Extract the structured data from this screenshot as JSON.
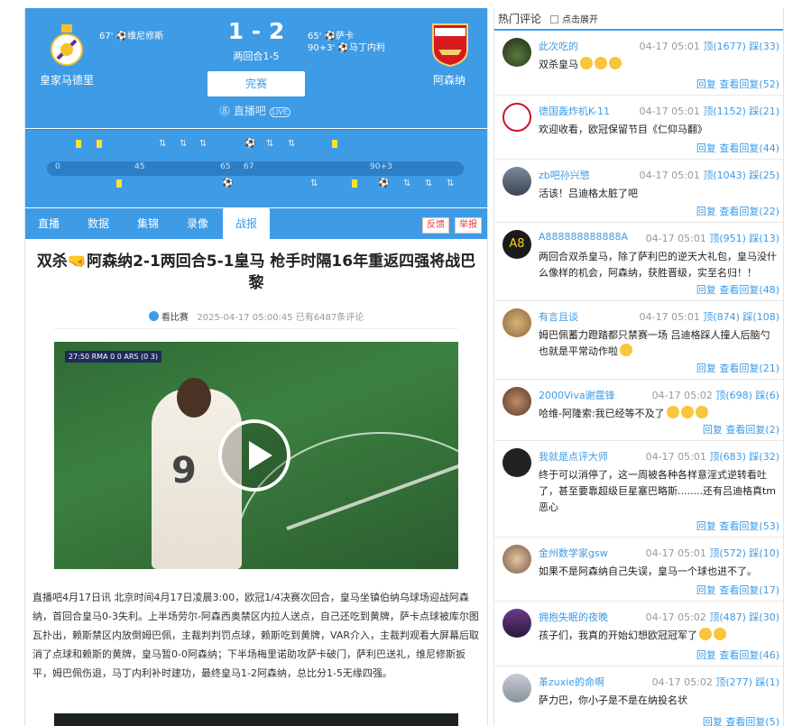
{
  "match": {
    "home_team": "皇家马德里",
    "away_team": "阿森纳",
    "home_scorers": [
      {
        "minute": "67'",
        "name": "维尼修斯"
      }
    ],
    "away_scorers": [
      {
        "minute": "65'",
        "name": "萨卡"
      },
      {
        "minute": "90+3'",
        "name": "马丁内利"
      }
    ],
    "score": "1 - 2",
    "aggregate": "两回合1-5",
    "status": "完赛",
    "brand": "直播吧",
    "brand_tag": "LIVE",
    "timeline_ticks": [
      "0",
      "45",
      "65",
      "67",
      "90+3"
    ]
  },
  "tabs": [
    "直播",
    "数据",
    "集锦",
    "录像",
    "战报"
  ],
  "active_tab": "战报",
  "actions": {
    "report": "反馈",
    "complain": "举报"
  },
  "article": {
    "title": "双杀🤜阿森纳2-1两回合5-1皇马 枪手时隔16年重返四强将战巴黎",
    "source": "看比赛",
    "time": "2025-04-17 05:00:45",
    "comments_count": "已有6487条评论",
    "video_overlay": {
      "clock": "27:50",
      "home": "RMA",
      "score": "0  0",
      "away": "ARS",
      "agg": "(0 3)"
    },
    "body": "直播吧4月17日讯 北京时间4月17日凌晨3:00，欧冠1/4决赛次回合，皇马坐镇伯纳乌球场迎战阿森纳，首回合皇马0-3失利。上半场劳尔-阿森西奥禁区内拉人送点，自己还吃到黄牌，萨卡点球被库尔图瓦扑出，赖斯禁区内放倒姆巴佩，主裁判判罚点球，赖斯吃到黄牌，VAR介入，主裁判观看大屏幕后取消了点球和赖斯的黄牌，皇马暂0-0阿森纳；下半场梅里诺助攻萨卡破门，萨利巴送礼，维尼修斯扳平，姆巴佩伤退，马丁内利补时建功，最终皇马1-2阿森纳，总比分1-5无缘四强。"
  },
  "hot_comments": {
    "title": "热门评论",
    "expand": "点击展开",
    "reply_label": "回复",
    "view_label": "查看回复",
    "up_label": "顶",
    "down_label": "踩",
    "items": [
      {
        "user": "此次吃的",
        "time": "04-17 05:01",
        "up": "1677",
        "down": "33",
        "text": "双杀皇马",
        "emojis": 3,
        "replies": "52"
      },
      {
        "user": "德国轰炸机K-11",
        "time": "04-17 05:01",
        "up": "1152",
        "down": "21",
        "text": "欢迎收看，欧冠保留节目《仁仰马翻》",
        "emojis": 0,
        "replies": "44"
      },
      {
        "user": "zb吧孙兴慜",
        "time": "04-17 05:01",
        "up": "1043",
        "down": "25",
        "text": "活该！吕迪格太脏了吧",
        "emojis": 0,
        "replies": "22"
      },
      {
        "user": "A888888888888A",
        "time": "04-17 05:01",
        "up": "951",
        "down": "13",
        "text": "两回合双杀皇马，除了萨利巴的逆天大礼包，皇马没什么像样的机会，阿森纳，获胜晋级，实至名归！！",
        "emojis": 0,
        "replies": "48"
      },
      {
        "user": "有言且谈",
        "time": "04-17 05:01",
        "up": "874",
        "down": "108",
        "text": "姆巴佩蓄力蹬踏都只禁赛一场 吕迪格踩人撞人后脑勺也就是平常动作啦",
        "emojis": 1,
        "replies": "21"
      },
      {
        "user": "2000Viva谢霆锋",
        "time": "04-17 05:02",
        "up": "698",
        "down": "6",
        "text": "哈维-阿隆索:我已经等不及了",
        "emojis": 3,
        "replies": "2"
      },
      {
        "user": "我就是点评大师",
        "time": "04-17 05:01",
        "up": "683",
        "down": "32",
        "text": "终于可以消停了，这一周被各种各样意淫式逆转看吐了，甚至要靠超级巨星塞巴略斯........还有吕迪格真tm恶心",
        "emojis": 0,
        "replies": "53"
      },
      {
        "user": "金州数学家gsw",
        "time": "04-17 05:01",
        "up": "572",
        "down": "10",
        "text": "如果不是阿森纳自己失误，皇马一个球也进不了。",
        "emojis": 0,
        "replies": "17"
      },
      {
        "user": "拥抱失眠的夜晚",
        "time": "04-17 05:02",
        "up": "487",
        "down": "30",
        "text": "孩子们，我真的开始幻想欧冠冠军了",
        "emojis": 2,
        "replies": "46"
      },
      {
        "user": "革zuxie的命啊",
        "time": "04-17 05:02",
        "up": "277",
        "down": "1",
        "text": "萨力巴，你小子是不是在纳投名状",
        "emojis": 0,
        "replies": "5"
      }
    ]
  },
  "colors": {
    "accent": "#3e9be6",
    "card_yellow": "#ffe033",
    "alert": "#e83b3b",
    "arsenal_red": "#d71920"
  }
}
